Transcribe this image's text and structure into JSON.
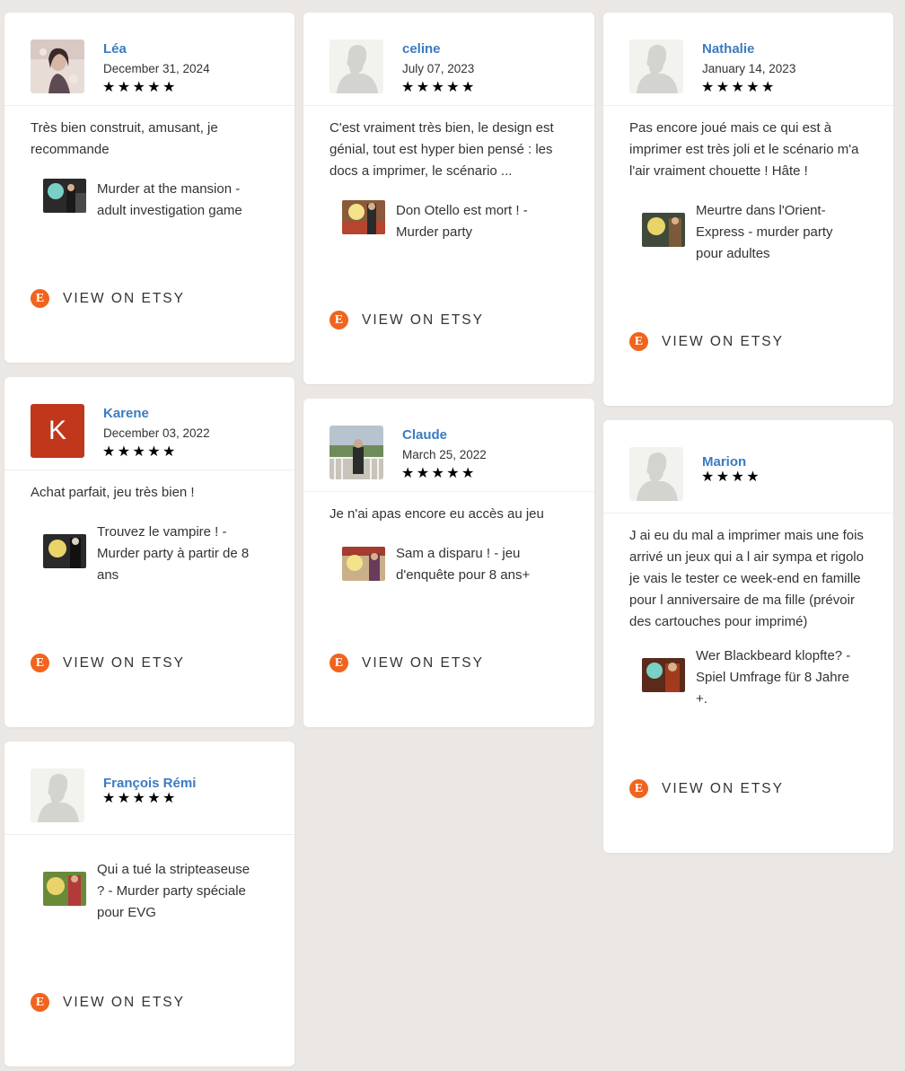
{
  "cta_label": "VIEW ON ETSY",
  "etsy_icon": "E",
  "colors": {
    "accent": "#3b7bc1",
    "etsy": "#f1641e",
    "background": "#ebe7e4",
    "karene_avatar": "#c0371b"
  },
  "reviews": [
    {
      "name": "Léa",
      "date": "December 31, 2024",
      "rating": 5,
      "stars": "★★★★★",
      "avatar": "photo-portrait",
      "text": "Très bien construit, amusant, je recommande",
      "product": "Murder at the mansion - adult investigation game"
    },
    {
      "name": "celine",
      "date": "July 07, 2023",
      "rating": 5,
      "stars": "★★★★★",
      "avatar": "default-silhouette",
      "text": "C'est vraiment très bien, le design est génial, tout est hyper bien pensé : les docs a imprimer, le scénario ...",
      "product": "Don Otello est mort ! - Murder party"
    },
    {
      "name": "Nathalie",
      "date": "January 14, 2023",
      "rating": 5,
      "stars": "★★★★★",
      "avatar": "default-silhouette",
      "text": "Pas encore joué mais ce qui est à imprimer est très joli et le scénario m'a l'air vraiment chouette ! Hâte !",
      "product": "Meurtre dans l'Orient-Express - murder party pour adultes"
    },
    {
      "name": "Karene",
      "date": "December 03, 2022",
      "rating": 5,
      "stars": "★★★★★",
      "avatar": "letter-avatar",
      "avatar_letter": "K",
      "text": "Achat parfait, jeu très bien !",
      "product": "Trouvez le vampire ! - Murder party à partir de 8 ans"
    },
    {
      "name": "Claude",
      "date": "March 25, 2022",
      "rating": 5,
      "stars": "★★★★★",
      "avatar": "photo-outdoor",
      "text": "Je n'ai apas encore eu accès au jeu",
      "product": "Sam a disparu ! - jeu d'enquête pour 8 ans+"
    },
    {
      "name": "Marion",
      "date": "",
      "rating": 4,
      "stars": "★★★★",
      "avatar": "default-silhouette",
      "text": "J ai eu du mal a imprimer mais une fois arrivé un jeux qui a l air sympa et rigolo je vais le tester ce week-end en famille pour l anniversaire de ma fille (prévoir des cartouches pour imprimé)",
      "product": "Wer Blackbeard klopfte? - Spiel Umfrage für 8 Jahre +."
    },
    {
      "name": "François Rémi",
      "date": "",
      "rating": 5,
      "stars": "★★★★★",
      "avatar": "default-silhouette",
      "text": "",
      "product": "Qui a tué la stripteaseuse ? - Murder party spéciale pour EVG"
    }
  ]
}
